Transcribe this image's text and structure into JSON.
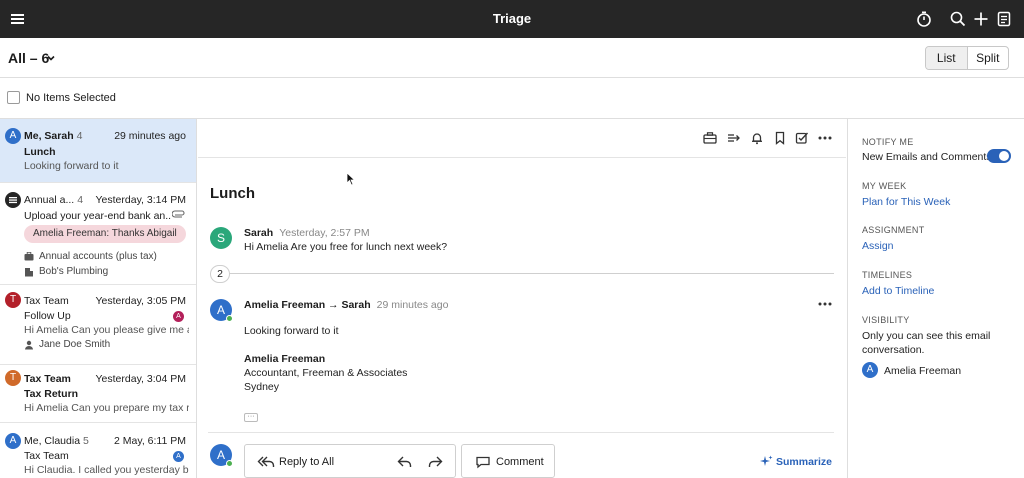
{
  "app": {
    "title": "Triage"
  },
  "filter": {
    "label": "All – 6",
    "view_options": [
      "List",
      "Split"
    ],
    "active_view": "List"
  },
  "selection": {
    "label": "No Items Selected"
  },
  "colors": {
    "accent": "#2a62b8",
    "topbar": "#262626",
    "selected_row": "#dbe8f9"
  },
  "list": {
    "items": [
      {
        "avatar": "A",
        "avatar_color": "#2f6fc9",
        "from": "Me, Sarah",
        "count": "4",
        "time": "29 minutes ago",
        "subject": "Lunch",
        "preview": "Looking forward to it"
      },
      {
        "avatar": "list-icon",
        "avatar_color": "#262626",
        "from": "Annual a...",
        "count": "4",
        "time": "Yesterday, 3:14 PM",
        "subject": "Upload your year-end bank an...",
        "pill": "Amelia Freeman: Thanks Abigail",
        "meta1": "Annual accounts (plus tax)",
        "meta2": "Bob's Plumbing"
      },
      {
        "avatar": "T",
        "avatar_color": "#b3202a",
        "from": "Tax Team",
        "time": "Yesterday, 3:05 PM",
        "subject": "Follow Up",
        "preview": "Hi Amelia Can you please give me a ...",
        "mini_avatar": "A",
        "mini_color": "#b3205a",
        "meta1": "Jane Doe Smith"
      },
      {
        "avatar": "T",
        "avatar_color": "#d06a2a",
        "from": "Tax Team",
        "time": "Yesterday, 3:04 PM",
        "subject": "Tax Return",
        "preview": "Hi Amelia Can you prepare my tax r..."
      },
      {
        "avatar": "A",
        "avatar_color": "#2f6fc9",
        "from": "Me, Claudia",
        "count": "5",
        "time": "2 May, 6:11 PM",
        "subject": "Tax Team",
        "preview": "Hi Claudia. I called you yesterday bu...",
        "mini_avatar": "A",
        "mini_color": "#2f6fc9"
      }
    ]
  },
  "conversation": {
    "subject": "Lunch",
    "collapsed_count": "2",
    "messages": [
      {
        "avatar": "S",
        "avatar_color": "#2aa77a",
        "from": "Sarah",
        "time": "Yesterday, 2:57 PM",
        "body": "Hi Amelia Are you free for lunch next week?"
      },
      {
        "avatar": "A",
        "avatar_color": "#2f6fc9",
        "from": "Amelia Freeman → Sarah",
        "time": "29 minutes ago",
        "body": "Looking forward to it",
        "signature_name": "Amelia Freeman",
        "signature_line1": "Accountant, Freeman & Associates",
        "signature_line2": "Sydney"
      }
    ],
    "reply_avatar": "A",
    "reply_label": "Reply to All",
    "comment_label": "Comment",
    "summarize_label": "Summarize"
  },
  "side_panel": {
    "notify_heading": "NOTIFY ME",
    "notify_text": "New Emails and Comments",
    "notify_on": true,
    "week_heading": "MY WEEK",
    "week_link": "Plan for This Week",
    "assignment_heading": "ASSIGNMENT",
    "assignment_link": "Assign",
    "timelines_heading": "TIMELINES",
    "timelines_link": "Add to Timeline",
    "visibility_heading": "VISIBILITY",
    "visibility_text1": "Only you can see this email",
    "visibility_text2": "conversation.",
    "visibility_avatar": "A",
    "visibility_user": "Amelia Freeman"
  }
}
